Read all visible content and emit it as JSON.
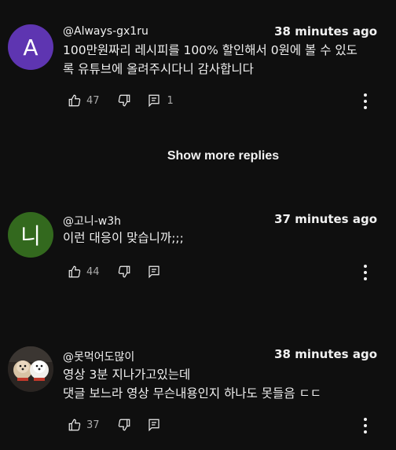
{
  "comments": [
    {
      "avatar_letter": "A",
      "avatar_color": "#5e35b1",
      "author": "@Always-gx1ru",
      "time": "38 minutes ago",
      "text_line1": "100만원짜리 레시피를 100% 할인해서 0원에 볼 수 있도",
      "text_line2": "록 유튜브에 올려주시다니 감사합니다",
      "likes": "47",
      "replies": "1"
    },
    {
      "avatar_letter": "니",
      "avatar_color": "#33691e",
      "author": "@고니-w3h",
      "time": "37 minutes ago",
      "text_line1": "이런 대응이 맞습니까;;;",
      "likes": "44"
    },
    {
      "avatar_letter": "",
      "author": "@못먹어도많이",
      "time": "38 minutes ago",
      "text_line1": "영상 3분 지나가고있는데",
      "text_line2": "댓글 보느라 영상 무슨내용인지 하나도 못들음  ㄷㄷ",
      "likes": "37"
    }
  ],
  "show_more_replies": "Show more replies",
  "icons": {
    "like": "thumb-up-icon",
    "dislike": "thumb-down-icon",
    "reply": "comment-icon",
    "more": "more-vert-icon"
  }
}
